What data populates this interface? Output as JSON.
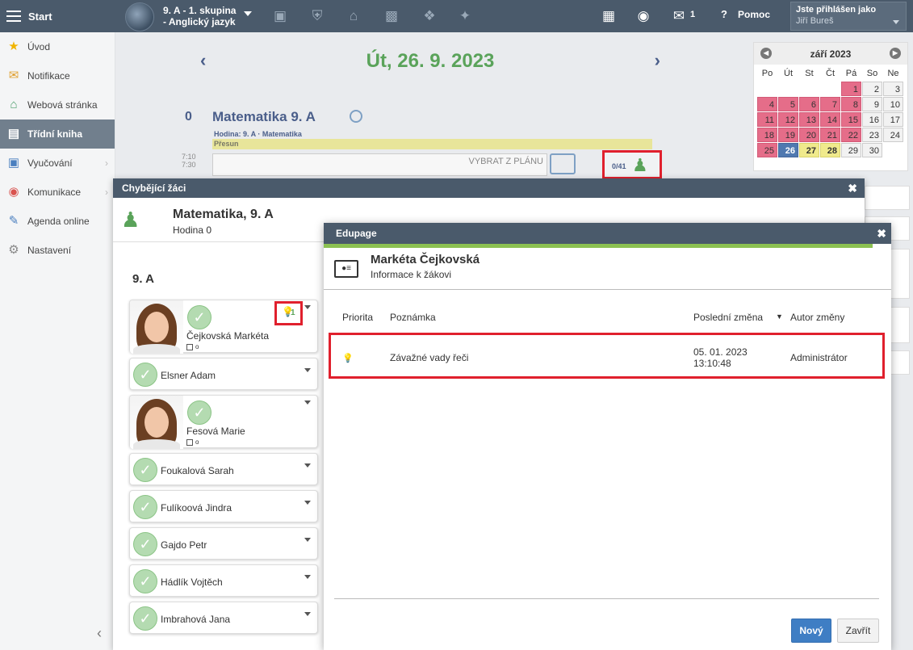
{
  "topbar": {
    "start_label": "Start",
    "class_line1": "9. A - 1. skupina",
    "class_line2": "- Anglický jazyk",
    "messages_count": "1",
    "help_label": "Pomoc",
    "user_label": "Jste přihlášen jako",
    "user_name": "Jiří Bureš"
  },
  "sidebar": {
    "items": [
      {
        "label": "Úvod",
        "icon": "star-icon"
      },
      {
        "label": "Notifikace",
        "icon": "envelope-icon"
      },
      {
        "label": "Webová stránka",
        "icon": "house-icon"
      },
      {
        "label": "Třídní kniha",
        "icon": "book-icon"
      },
      {
        "label": "Vyučování",
        "icon": "open-book-icon"
      },
      {
        "label": "Komunikace",
        "icon": "chat-icon"
      },
      {
        "label": "Agenda online",
        "icon": "pen-icon"
      },
      {
        "label": "Nastavení",
        "icon": "gear-icon"
      }
    ]
  },
  "main": {
    "date_title": "Út, 26. 9. 2023",
    "lesson_number": "0",
    "lesson_title": "Matematika  9. A",
    "lesson_sub": "Hodina:  9. A · Matematika",
    "presun": "Přesun",
    "time_from": "7:10",
    "time_to": "7:30",
    "plan_button": "VYBRAT Z PLÁNU",
    "absent_count": "0/41"
  },
  "calendar": {
    "month": "září 2023",
    "day_names": [
      "Po",
      "Út",
      "St",
      "Čt",
      "Pá",
      "So",
      "Ne"
    ],
    "weeks": [
      [
        {
          "d": "",
          "s": "blank"
        },
        {
          "d": "",
          "s": "blank"
        },
        {
          "d": "",
          "s": "blank"
        },
        {
          "d": "",
          "s": "blank"
        },
        {
          "d": "1",
          "s": "pink"
        },
        {
          "d": "2",
          "s": ""
        },
        {
          "d": "3",
          "s": ""
        }
      ],
      [
        {
          "d": "4",
          "s": "pink"
        },
        {
          "d": "5",
          "s": "pink"
        },
        {
          "d": "6",
          "s": "pink"
        },
        {
          "d": "7",
          "s": "pink"
        },
        {
          "d": "8",
          "s": "pink"
        },
        {
          "d": "9",
          "s": ""
        },
        {
          "d": "10",
          "s": ""
        }
      ],
      [
        {
          "d": "11",
          "s": "pink"
        },
        {
          "d": "12",
          "s": "pink"
        },
        {
          "d": "13",
          "s": "pink"
        },
        {
          "d": "14",
          "s": "pink"
        },
        {
          "d": "15",
          "s": "pink"
        },
        {
          "d": "16",
          "s": ""
        },
        {
          "d": "17",
          "s": ""
        }
      ],
      [
        {
          "d": "18",
          "s": "pink"
        },
        {
          "d": "19",
          "s": "pink"
        },
        {
          "d": "20",
          "s": "pink"
        },
        {
          "d": "21",
          "s": "pink"
        },
        {
          "d": "22",
          "s": "pink"
        },
        {
          "d": "23",
          "s": ""
        },
        {
          "d": "24",
          "s": ""
        }
      ],
      [
        {
          "d": "25",
          "s": "pink"
        },
        {
          "d": "26",
          "s": "today"
        },
        {
          "d": "27",
          "s": "yellow"
        },
        {
          "d": "28",
          "s": "yellow"
        },
        {
          "d": "29",
          "s": ""
        },
        {
          "d": "30",
          "s": ""
        },
        {
          "d": "",
          "s": "blank"
        }
      ]
    ]
  },
  "absent_modal": {
    "header": "Chybějící žáci",
    "title": "Matematika, 9. A",
    "subtitle": "Hodina 0",
    "class_label": "9. A",
    "note_count": "1",
    "students": [
      {
        "name": "Čejkovská Markéta",
        "photo": true
      },
      {
        "name": "Elsner Adam",
        "photo": false
      },
      {
        "name": "Fesová Marie",
        "photo": true
      },
      {
        "name": "Foukalová Sarah",
        "photo": false
      },
      {
        "name": "Fulíkoová Jindra",
        "photo": false
      },
      {
        "name": "Gajdo Petr",
        "photo": false
      },
      {
        "name": "Hádlík Vojtěch",
        "photo": false
      },
      {
        "name": "Imbrahová Jana",
        "photo": false
      }
    ]
  },
  "info_modal": {
    "header": "Edupage",
    "title": "Markéta Čejkovská",
    "subtitle": "Informace k žákovi",
    "columns": {
      "priority": "Priorita",
      "note": "Poznámka",
      "last_change": "Poslední změna",
      "author": "Autor změny"
    },
    "row": {
      "note": "Závažné vady řeči",
      "date": "05. 01. 2023",
      "time": "13:10:48",
      "author": "Administrátor"
    },
    "new_button": "Nový",
    "close_button": "Zavřít"
  },
  "colors": {
    "header_bg": "#4a5a6b",
    "accent_green": "#5aa35a",
    "highlight_red": "#e0202d",
    "primary_blue": "#3f7ec4"
  }
}
